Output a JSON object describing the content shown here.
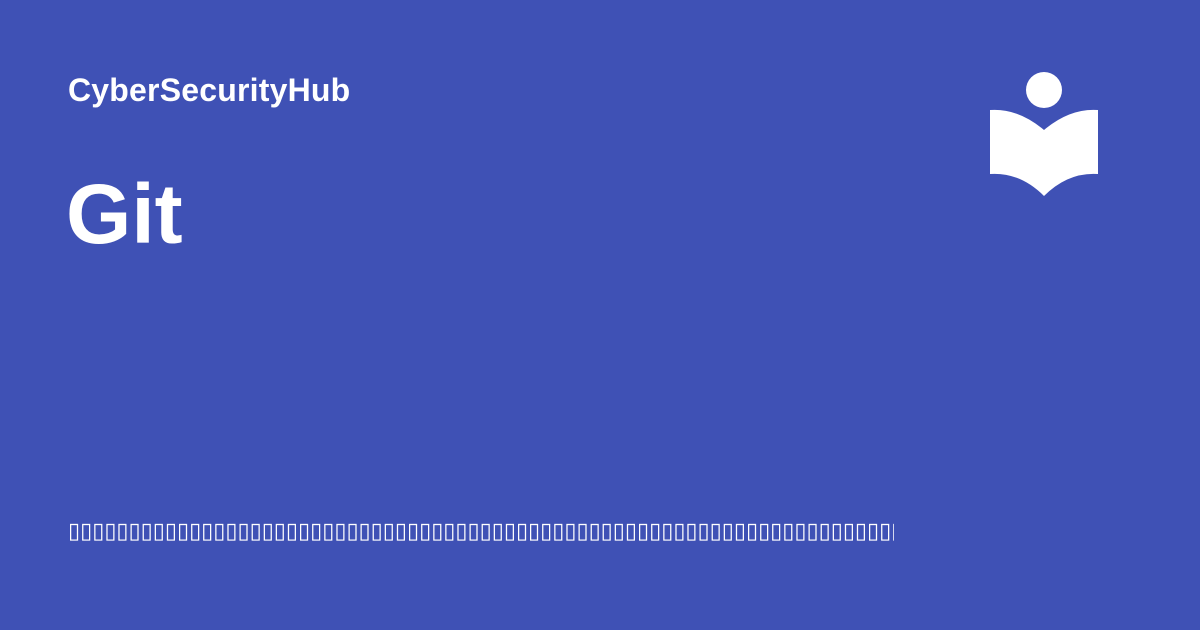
{
  "colors": {
    "background": "#3f51b5",
    "foreground": "#ffffff"
  },
  "site": {
    "name": "CyberSecurityHub",
    "logo_icon": "open-book-reader-icon"
  },
  "page": {
    "title": "Git",
    "description": "▯▯▯▯▯▯▯▯▯▯▯▯▯▯▯▯▯▯▯▯▯▯▯▯▯▯▯▯▯▯▯▯▯▯▯▯▯▯▯▯▯▯▯▯▯▯▯▯▯▯▯▯▯▯▯▯▯▯▯▯▯▯▯▯▯▯▯▯▯▯▯▯▯▯▯▯▯▯▯"
  }
}
